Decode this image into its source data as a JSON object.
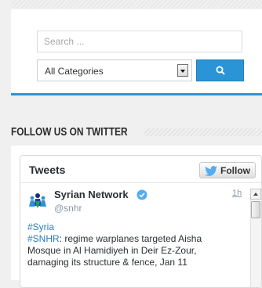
{
  "search": {
    "placeholder": "Search ...",
    "category_selected": "All Categories"
  },
  "twitter_section": {
    "heading": "FOLLOW US ON TWITTER"
  },
  "timeline": {
    "title": "Tweets",
    "follow_label": "Follow",
    "tweet": {
      "author_name": "Syrian Network",
      "handle": "@snhr",
      "time": "1h",
      "text_line1": "#Syria",
      "text_line2_hash": "#SNHR",
      "text_line2_rest": ": regime warplanes targeted Aisha",
      "text_line3": "Mosque in Al Hamidiyeh in Deir Ez-Zour,",
      "text_line4": "damaging its structure & fence, Jan 11"
    }
  },
  "colors": {
    "accent": "#2a94d6",
    "twitter_blue": "#55acee",
    "hashtag": "#2b7bb9"
  },
  "icons": {
    "search_button": "search-icon",
    "follow_button": "twitter-bird-icon",
    "verified": "verified-badge-icon",
    "avatar": "people-group-icon"
  }
}
